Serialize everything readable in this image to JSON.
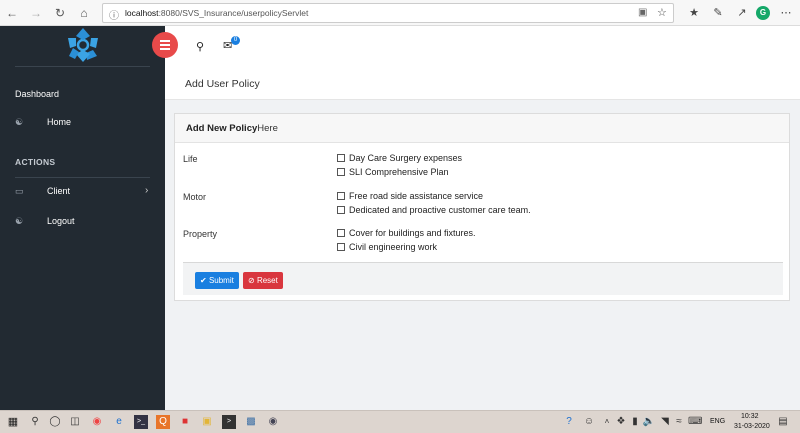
{
  "browser": {
    "url_host": "localhost",
    "url_path": ":8080/SVS_Insurance/userpolicyServlet",
    "icons": [
      "back-arrow",
      "forward-arrow",
      "refresh",
      "home",
      "info",
      "reading-view",
      "favorite-star",
      "favorites-list",
      "pen",
      "share",
      "extension",
      "more"
    ]
  },
  "sidebar": {
    "section_main": "Dashboard",
    "home": "Home",
    "section_actions": "ACTIONS",
    "client": "Client",
    "logout": "Logout"
  },
  "header": {
    "mail_badge": "0"
  },
  "page": {
    "title": "Add User Policy"
  },
  "card": {
    "title_bold": "Add New Policy",
    "title_rest": "Here",
    "categories": [
      {
        "name": "Life",
        "options": [
          "Day Care Surgery expenses",
          "SLI Comprehensive Plan"
        ]
      },
      {
        "name": "Motor",
        "options": [
          "Free road side assistance service",
          "Dedicated and proactive customer care team."
        ]
      },
      {
        "name": "Property",
        "options": [
          "Cover for buildings and fixtures.",
          "Civil engineering work"
        ]
      }
    ],
    "submit": "Submit",
    "reset": "Reset"
  },
  "taskbar": {
    "lang": "ENG",
    "time": "10:32",
    "date": "31-03-2020"
  },
  "colors": {
    "sidebar": "#222a32",
    "toggle": "#e84a4a",
    "submit": "#1a7fe0",
    "reset": "#d9363e",
    "badge": "#1a7fe0"
  }
}
